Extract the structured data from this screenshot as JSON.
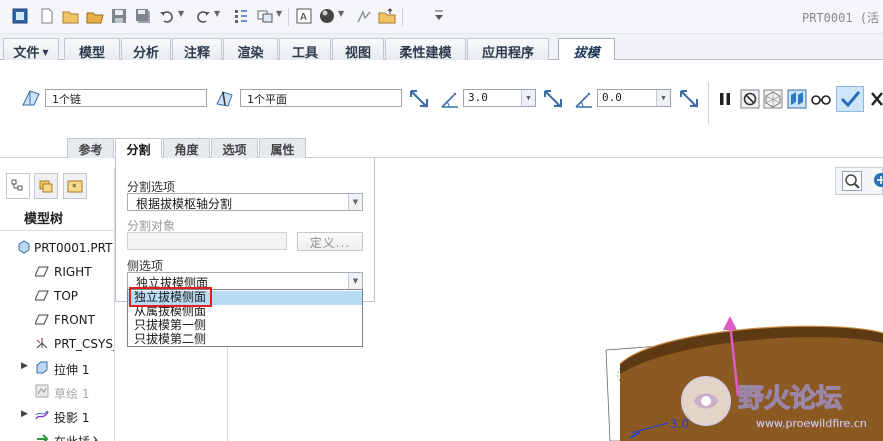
{
  "window": {
    "title": "PRT0001 (活"
  },
  "tabs": [
    {
      "label": "文件",
      "has_menu": true
    },
    {
      "label": "模型"
    },
    {
      "label": "分析"
    },
    {
      "label": "注释"
    },
    {
      "label": "渲染"
    },
    {
      "label": "工具"
    },
    {
      "label": "视图"
    },
    {
      "label": "柔性建模"
    },
    {
      "label": "应用程序"
    },
    {
      "label": "拔模",
      "active": true
    }
  ],
  "ribbon": {
    "draft_surface_value": "1个链",
    "draft_hinge_value": "1个平面",
    "angle1_value": "3.0",
    "angle2_value": "0.0"
  },
  "subtabs": [
    {
      "label": "参考"
    },
    {
      "label": "分割",
      "active": true
    },
    {
      "label": "角度"
    },
    {
      "label": "选项"
    },
    {
      "label": "属性"
    }
  ],
  "split_panel": {
    "split_options_label": "分割选项",
    "split_options_value": "根据拔模枢轴分割",
    "split_object_label": "分割对象",
    "define_button": "定义...",
    "side_options_label": "侧选项",
    "side_options_value": "独立拔模侧面",
    "dropdown_options": [
      "独立拔模侧面",
      "从属拔模侧面",
      "只拔模第一侧",
      "只拔模第二侧"
    ],
    "selected_index": 0
  },
  "model_tree": {
    "title": "模型树",
    "items": [
      {
        "label": "PRT0001.PRT",
        "icon": "part-icon"
      },
      {
        "label": "RIGHT",
        "icon": "datum-plane-icon"
      },
      {
        "label": "TOP",
        "icon": "datum-plane-icon"
      },
      {
        "label": "FRONT",
        "icon": "datum-plane-icon"
      },
      {
        "label": "PRT_CSYS_DEF",
        "icon": "csys-icon"
      },
      {
        "label": "拉伸 1",
        "icon": "extrude-icon",
        "expandable": true
      },
      {
        "label": "草绘 1",
        "icon": "sketch-icon",
        "dimmed": true
      },
      {
        "label": "投影 1",
        "icon": "projection-icon",
        "expandable": true
      },
      {
        "label": "在此插入",
        "icon": "insert-here-icon"
      }
    ]
  },
  "graphics": {
    "dimension_label": "3.0"
  },
  "watermark": {
    "title": "野火论坛",
    "url": "www.proewildfire.cn"
  },
  "colors": {
    "accent_blue": "#3b6ea8",
    "selection": "#b9dcf5",
    "highlight_red": "#e0201f",
    "model_brown": "#8a5a22",
    "arrow_magenta": "#e05ac8"
  }
}
